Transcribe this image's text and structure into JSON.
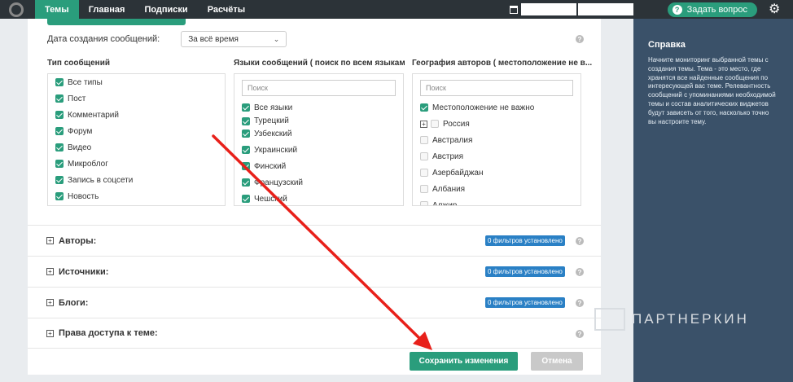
{
  "nav": {
    "tabs": [
      "Темы",
      "Главная",
      "Подписки",
      "Расчёты"
    ],
    "ask_label": "Задать вопрос"
  },
  "help": {
    "title": "Справка",
    "text": "Начните мониторинг выбранной темы с создания темы. Тема - это место, где хранятся все найденные сообщения по интересующей вас теме. Релевантность сообщений с упоминаниями необходимой темы и состав аналитических виджетов будут зависеть от того, насколько точно вы настроите тему."
  },
  "form": {
    "date_label": "Дата создания сообщений:",
    "date_value": "За всё время",
    "types": {
      "title": "Тип сообщений",
      "items": [
        "Все типы",
        "Пост",
        "Комментарий",
        "Форум",
        "Видео",
        "Микроблог",
        "Запись в соцсети",
        "Новость"
      ]
    },
    "languages": {
      "title": "Языки сообщений ( поиск по всем языкам )",
      "search_placeholder": "Поиск",
      "items": [
        "Все языки",
        "Турецкий",
        "Узбекский",
        "Украинский",
        "Финский",
        "Французский",
        "Чешский"
      ]
    },
    "geo": {
      "title": "География авторов ( местоположение не в...",
      "search_placeholder": "Поиск",
      "items": [
        "Местоположение не важно",
        "Россия",
        "Австралия",
        "Австрия",
        "Азербайджан",
        "Албания",
        "Алжир"
      ]
    },
    "sections": [
      {
        "label": "Авторы:",
        "badge": "0 фильтров установлено"
      },
      {
        "label": "Источники:",
        "badge": "0 фильтров установлено"
      },
      {
        "label": "Блоги:",
        "badge": "0 фильтров установлено"
      },
      {
        "label": "Права доступа к теме:",
        "badge": ""
      }
    ],
    "save_label": "Сохранить изменения",
    "cancel_label": "Отмена"
  },
  "watermark": "ПАРТНЕРКИН",
  "colors": {
    "accent": "#2a9d7c",
    "badge": "#2a80c5",
    "help_bg": "#3a5169",
    "arrow": "#e8201a"
  }
}
